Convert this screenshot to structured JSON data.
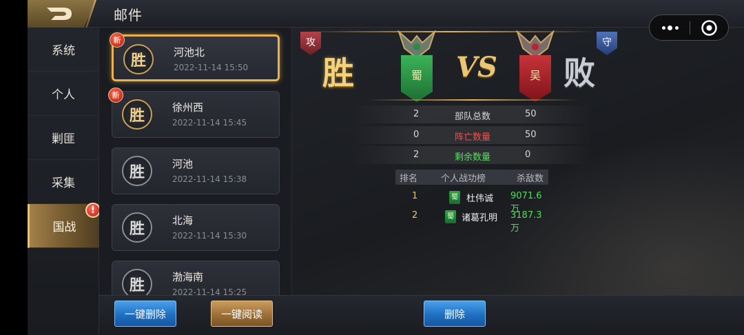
{
  "header": {
    "title": "邮件"
  },
  "nav": {
    "items": [
      {
        "label": "系统"
      },
      {
        "label": "个人"
      },
      {
        "label": "剿匪"
      },
      {
        "label": "采集"
      },
      {
        "label": "国战",
        "alert": "!"
      }
    ]
  },
  "mails": [
    {
      "result": "胜",
      "name": "河池北",
      "time": "2022-11-14   15:50",
      "new": "新"
    },
    {
      "result": "胜",
      "name": "徐州西",
      "time": "2022-11-14   15:45",
      "new": "新"
    },
    {
      "result": "胜",
      "name": "河池",
      "time": "2022-11-14   15:38"
    },
    {
      "result": "胜",
      "name": "北海",
      "time": "2022-11-14   15:30"
    },
    {
      "result": "胜",
      "name": "渤海南",
      "time": "2022-11-14   15:25"
    }
  ],
  "report": {
    "attack_label": "攻",
    "defend_label": "守",
    "attacker_result": "胜",
    "defender_result": "败",
    "vs": "VS",
    "attacker_faction": "蜀",
    "defender_faction": "吴",
    "stats": [
      {
        "label": "部队总数",
        "attacker": "2",
        "defender": "50",
        "color": "#e0e0e0"
      },
      {
        "label": "阵亡数量",
        "attacker": "0",
        "defender": "50",
        "color": "#ff4a4a"
      },
      {
        "label": "剩余数量",
        "attacker": "2",
        "defender": "0",
        "color": "#4fe05a"
      }
    ],
    "ranking": {
      "headers": {
        "rank": "排名",
        "name": "个人战功榜",
        "kills": "杀敌数"
      },
      "rows": [
        {
          "rank": "1",
          "faction": "蜀",
          "name": "杜伟诚",
          "kills": "9071.6万"
        },
        {
          "rank": "2",
          "faction": "蜀",
          "name": "诸葛孔明",
          "kills": "3187.3万"
        }
      ]
    }
  },
  "buttons": {
    "delete_all": "一键删除",
    "read_all": "一键阅读",
    "delete": "删除"
  }
}
